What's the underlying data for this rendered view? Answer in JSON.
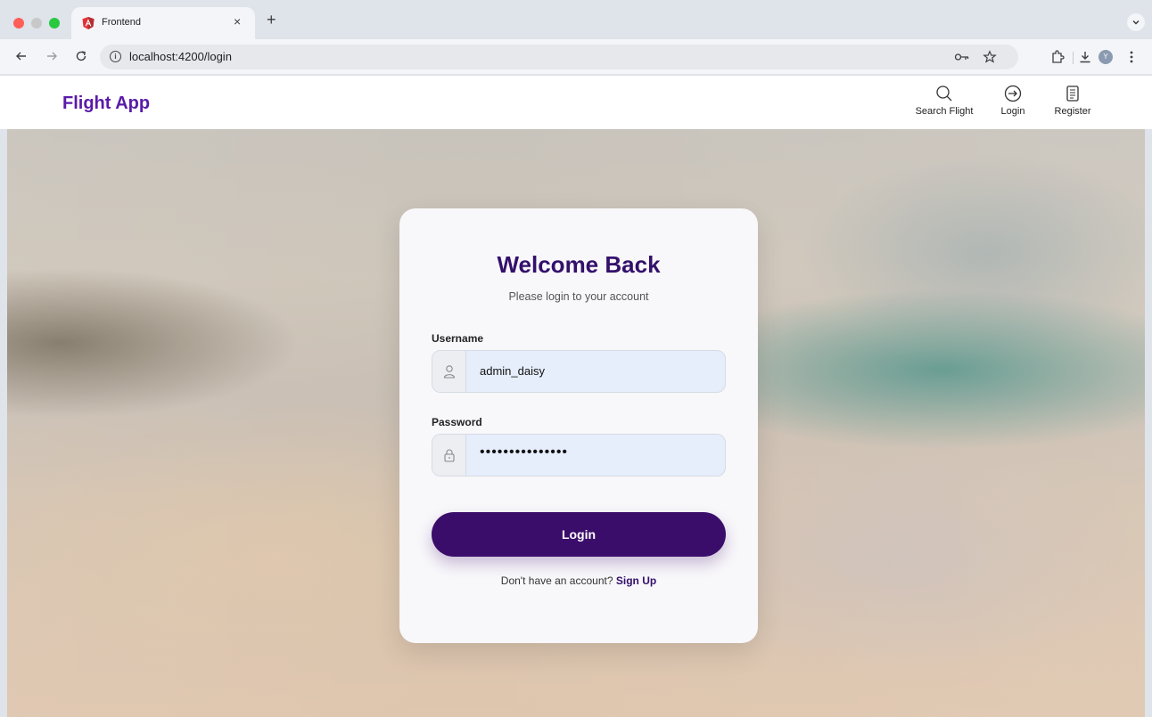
{
  "browser": {
    "tab_title": "Frontend",
    "tab_close": "×",
    "new_tab": "+",
    "url": "localhost:4200/login",
    "icons": [
      "back-icon",
      "forward-icon",
      "reload-icon",
      "info-icon",
      "password-key-icon",
      "star-icon",
      "extensions-icon",
      "download-icon",
      "profile-avatar",
      "more-menu-icon"
    ],
    "profile_initial": "Y"
  },
  "app": {
    "brand": "Flight App",
    "brand_color": "#5a1aa8",
    "nav": [
      {
        "label": "Search Flight",
        "icon": "search-icon"
      },
      {
        "label": "Login",
        "icon": "login-icon"
      },
      {
        "label": "Register",
        "icon": "register-icon"
      }
    ]
  },
  "login": {
    "title": "Welcome Back",
    "subtitle": "Please login to your account",
    "username_label": "Username",
    "username_value": "admin_daisy",
    "password_label": "Password",
    "password_value": "•••••••••••••••",
    "button_label": "Login",
    "signup_prompt": "Don't have an account?",
    "signup_link": "Sign Up",
    "accent_color": "#3b0d6b"
  }
}
